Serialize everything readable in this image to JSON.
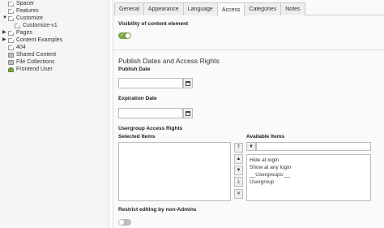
{
  "tree": {
    "items": [
      {
        "label": "Spacer",
        "icon": "page-icon"
      },
      {
        "label": "Features",
        "icon": "page-icon"
      },
      {
        "label": "Customize",
        "icon": "page-icon"
      },
      {
        "label": "Customize-v1",
        "icon": "page-icon"
      },
      {
        "label": "Pages",
        "icon": "page-icon"
      },
      {
        "label": "Content Examples",
        "icon": "page-icon"
      },
      {
        "label": "404",
        "icon": "page-icon"
      },
      {
        "label": "Shared Content",
        "icon": "folder-icon"
      },
      {
        "label": "File Collections",
        "icon": "folder-icon"
      },
      {
        "label": "Frontend User",
        "icon": "user-folder-icon"
      }
    ]
  },
  "tabs": [
    "General",
    "Appearance",
    "Language",
    "Access",
    "Categories",
    "Notes"
  ],
  "active_tab": "Access",
  "form": {
    "visibility_label": "Visibility of content element",
    "section_title": "Publish Dates and Access Rights",
    "publish_date_label": "Publish Date",
    "expiration_date_label": "Expiration Date",
    "usergroup_label": "Usergroup Access Rights",
    "selected_items_label": "Selected Items",
    "available_items_label": "Available Items",
    "available_items": [
      "Hide at login",
      "Show at any login",
      "__Usergroups:__",
      "Usergroup"
    ],
    "restrict_label": "Restrict editing by non-Admins"
  },
  "colors": {
    "toggle_on": "#79a548",
    "toggle_off": "#bdbdbd"
  }
}
